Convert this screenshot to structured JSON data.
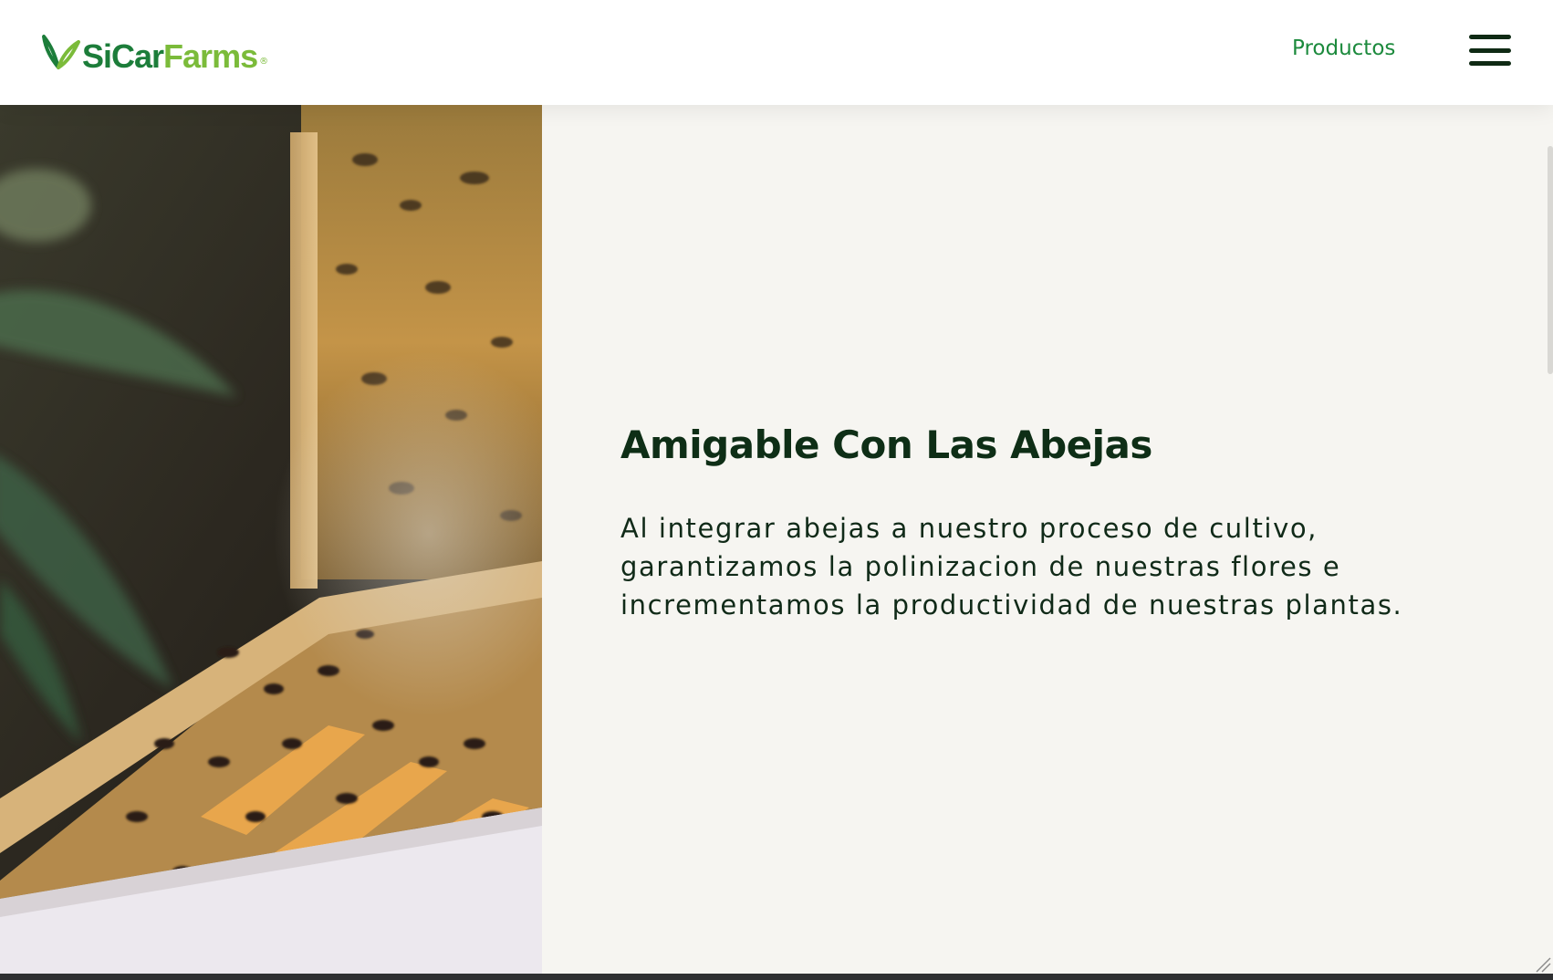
{
  "header": {
    "logo": {
      "brand_part1": "SiCar",
      "brand_part2": "Farms",
      "registered_mark": "®",
      "icon": "leaf-logo-icon"
    },
    "nav": {
      "products_label": "Productos"
    },
    "menu_icon": "hamburger-menu-icon"
  },
  "hero": {
    "image_icon": "beehive-photo"
  },
  "feature": {
    "title": "Amigable Con Las Abejas",
    "description": "Al integrar abejas a nuestro proceso de cultivo, garantizamos la polinizacion de nuestras flores e incrementamos la productividad de nuestras plantas."
  },
  "colors": {
    "brand_dark_green": "#1c7d3a",
    "brand_light_green": "#7bbb3a",
    "nav_link_green": "#1c8a3d",
    "title_dark": "#0e2e16",
    "content_bg": "#f6f5f1"
  }
}
